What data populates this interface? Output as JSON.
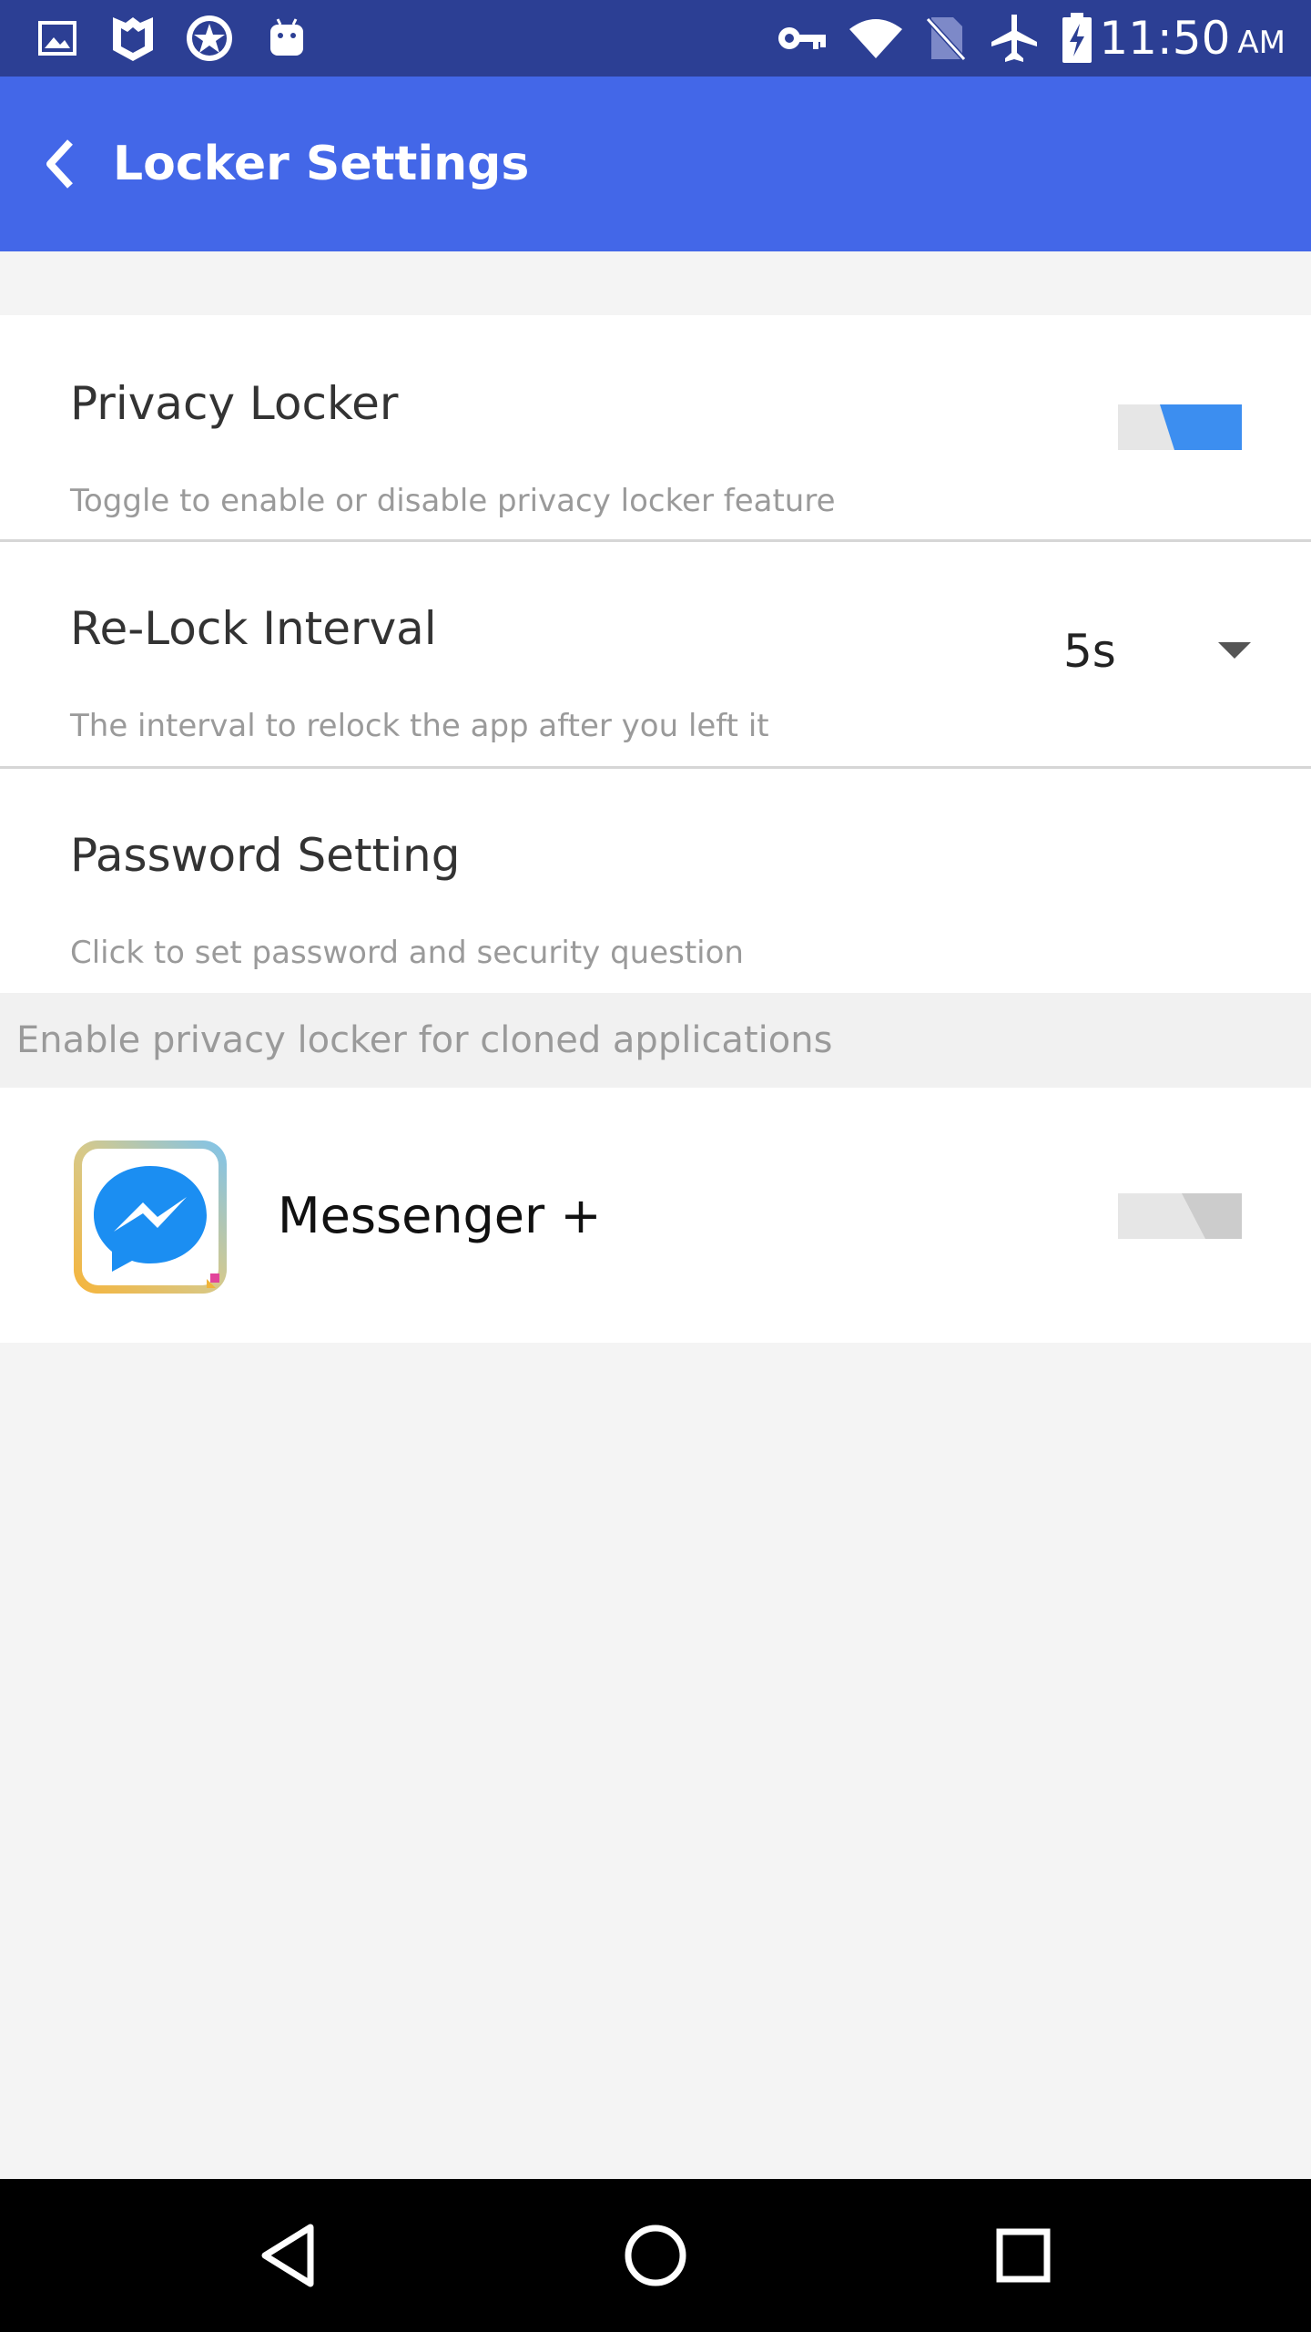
{
  "status_bar": {
    "time": "11:50",
    "ampm": "AM",
    "left_icons": [
      "image-icon",
      "shield-m-icon",
      "badge-star-icon",
      "android-icon"
    ],
    "right_icons": [
      "key-icon",
      "wifi-icon",
      "no-sim-icon",
      "airplane-icon",
      "battery-charging-icon"
    ]
  },
  "app_bar": {
    "title": "Locker Settings",
    "back_icon": "chevron-left-icon",
    "color": "#4367e8"
  },
  "settings": {
    "privacy_locker": {
      "title": "Privacy Locker",
      "subtitle": "Toggle to enable or disable privacy locker feature",
      "enabled": true
    },
    "relock_interval": {
      "title": "Re-Lock Interval",
      "subtitle": "The interval to relock the app after you left it",
      "value": "5s"
    },
    "password_setting": {
      "title": "Password Setting",
      "subtitle": "Click to set password and security question"
    }
  },
  "cloned_section": {
    "header": "Enable privacy locker for cloned applications",
    "apps": [
      {
        "name": "Messenger +",
        "icon": "messenger-icon",
        "enabled": false
      }
    ]
  },
  "colors": {
    "toggle_on": "#3c8ef0",
    "toggle_off": "#cccccc",
    "status_bar": "#2c3f94"
  },
  "nav_bar": {
    "icons": [
      "back-triangle-icon",
      "home-circle-icon",
      "recents-square-icon"
    ]
  }
}
